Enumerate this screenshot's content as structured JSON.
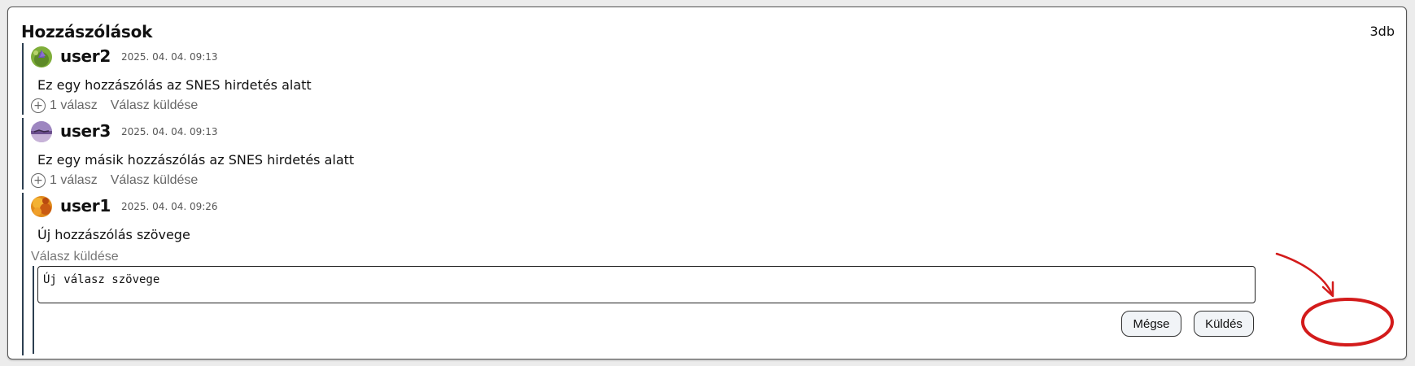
{
  "panel": {
    "title": "Hozzászólások",
    "count": "3db"
  },
  "comments": [
    {
      "username": "user2",
      "timestamp": "2025. 04. 04. 09:13",
      "text": "Ez egy hozzászólás az SNES hirdetés alatt",
      "reply_count": "1 válasz",
      "reply_link": "Válasz küldése"
    },
    {
      "username": "user3",
      "timestamp": "2025. 04. 04. 09:13",
      "text": "Ez egy másik hozzászólás az SNES hirdetés alatt",
      "reply_count": "1 válasz",
      "reply_link": "Válasz küldése"
    },
    {
      "username": "user1",
      "timestamp": "2025. 04. 04. 09:26",
      "text": "Új hozzászólás szövege"
    }
  ],
  "reply_form": {
    "label": "Válasz küldése",
    "value": "Új válasz szövege",
    "cancel_label": "Mégse",
    "send_label": "Küldés"
  },
  "colors": {
    "thread_line": "#2c3e50",
    "annotation": "#d31b1b"
  },
  "icons": {
    "expand": "plus-circle-icon"
  }
}
